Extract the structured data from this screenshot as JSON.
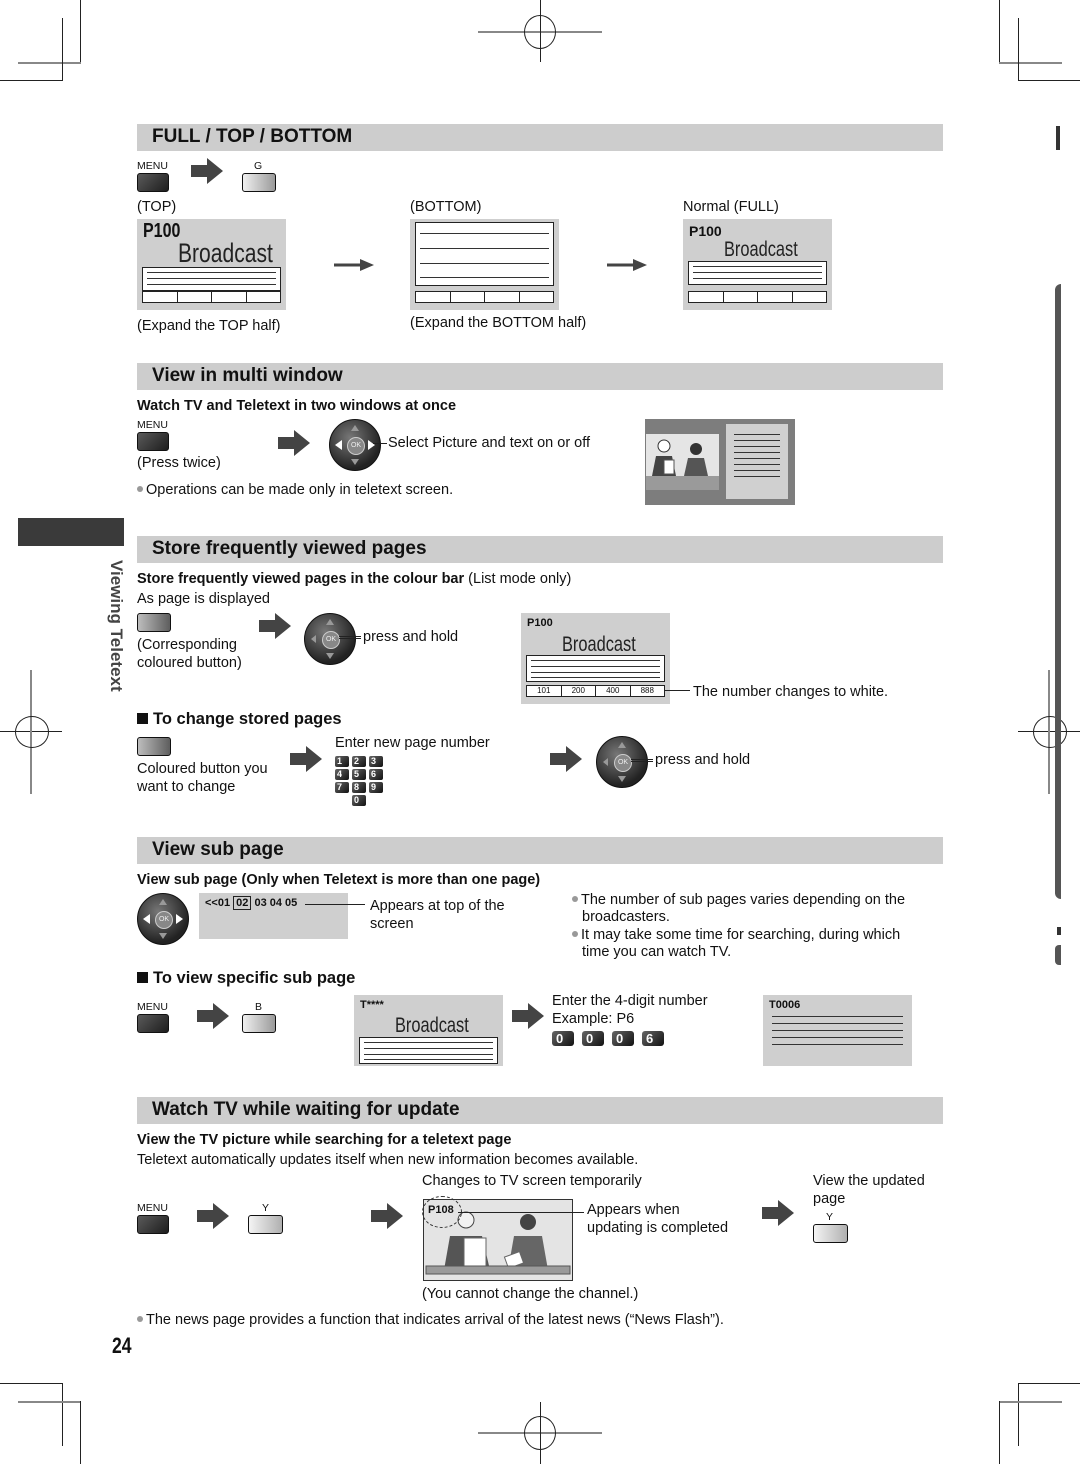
{
  "side_tab": {
    "label": "Viewing Teletext"
  },
  "page_number": "24",
  "sections": {
    "full_top_bottom": {
      "title": "FULL / TOP / BOTTOM",
      "keys": {
        "menu": "MENU",
        "colour": "G"
      },
      "states": [
        {
          "heading": "(TOP)",
          "page": "P100",
          "broadcast": "Broadcast",
          "caption": "(Expand the TOP half)"
        },
        {
          "heading": "(BOTTOM)",
          "caption": "(Expand the BOTTOM half)"
        },
        {
          "heading": "Normal (FULL)",
          "page": "P100",
          "broadcast": "Broadcast"
        }
      ]
    },
    "multi_window": {
      "title": "View in multi window",
      "subtitle": "Watch TV and Teletext in two windows at once",
      "keys": {
        "menu": "MENU",
        "ok": "OK"
      },
      "press_note": "(Press twice)",
      "select_text": "Select Picture and text on or off",
      "note": "Operations can be made only in teletext screen."
    },
    "store_pages": {
      "title": "Store frequently viewed pages",
      "subtitle_bold": "Store frequently viewed pages in the colour bar",
      "subtitle_normal": "(List mode only)",
      "as_displayed": "As page is displayed",
      "colour_caption_1": "(Corresponding",
      "colour_caption_2": "coloured button)",
      "ok": "OK",
      "press_hold": "press and hold",
      "screen": {
        "page": "P100",
        "broadcast": "Broadcast",
        "fastext": [
          "101",
          "200",
          "400",
          "888"
        ]
      },
      "number_note": "The number changes to white.",
      "change": {
        "heading": "To change stored pages",
        "button_caption_1": "Coloured button you",
        "button_caption_2": "want to change",
        "enter_text": "Enter new page number",
        "keypad": [
          "1",
          "2",
          "3",
          "4",
          "5",
          "6",
          "7",
          "8",
          "9",
          "0"
        ],
        "press_hold": "press and hold",
        "ok": "OK"
      }
    },
    "sub_page": {
      "title": "View sub page",
      "subtitle": "View sub page (Only when Teletext is more than one page)",
      "ok": "OK",
      "indicator_prefix": "<<01",
      "indicator_current": "02",
      "indicator_suffix": "03 04 05",
      "appears_1": "Appears at top of the",
      "appears_2": "screen",
      "notes": [
        {
          "line1": "The number of sub pages varies depending on the",
          "line2": "broadcasters."
        },
        {
          "line1": "It may take some time for searching, during which",
          "line2": "time you can watch TV."
        }
      ],
      "specific": {
        "heading": "To view specific sub page",
        "keys": {
          "menu": "MENU",
          "colour": "B"
        },
        "screen_page": "T****",
        "broadcast": "Broadcast",
        "enter_text": "Enter the 4-digit number",
        "example": "Example: P6",
        "digits": [
          "0",
          "0",
          "0",
          "6"
        ],
        "result_page": "T0006"
      }
    },
    "watch_update": {
      "title": "Watch TV while waiting for update",
      "subtitle": "View the TV picture while searching for a teletext page",
      "description": "Teletext automatically updates itself when new information becomes available.",
      "changes_text": "Changes to TV screen temporarily",
      "keys": {
        "menu": "MENU",
        "colour": "Y",
        "colour2": "Y"
      },
      "page_badge": "P108",
      "appears_1": "Appears when",
      "appears_2": "updating is completed",
      "cannot_change": "(You cannot change the channel.)",
      "view_updated_1": "View the updated",
      "view_updated_2": "page",
      "note": "The news page provides a function that indicates arrival of the latest news (“News Flash”)."
    }
  }
}
